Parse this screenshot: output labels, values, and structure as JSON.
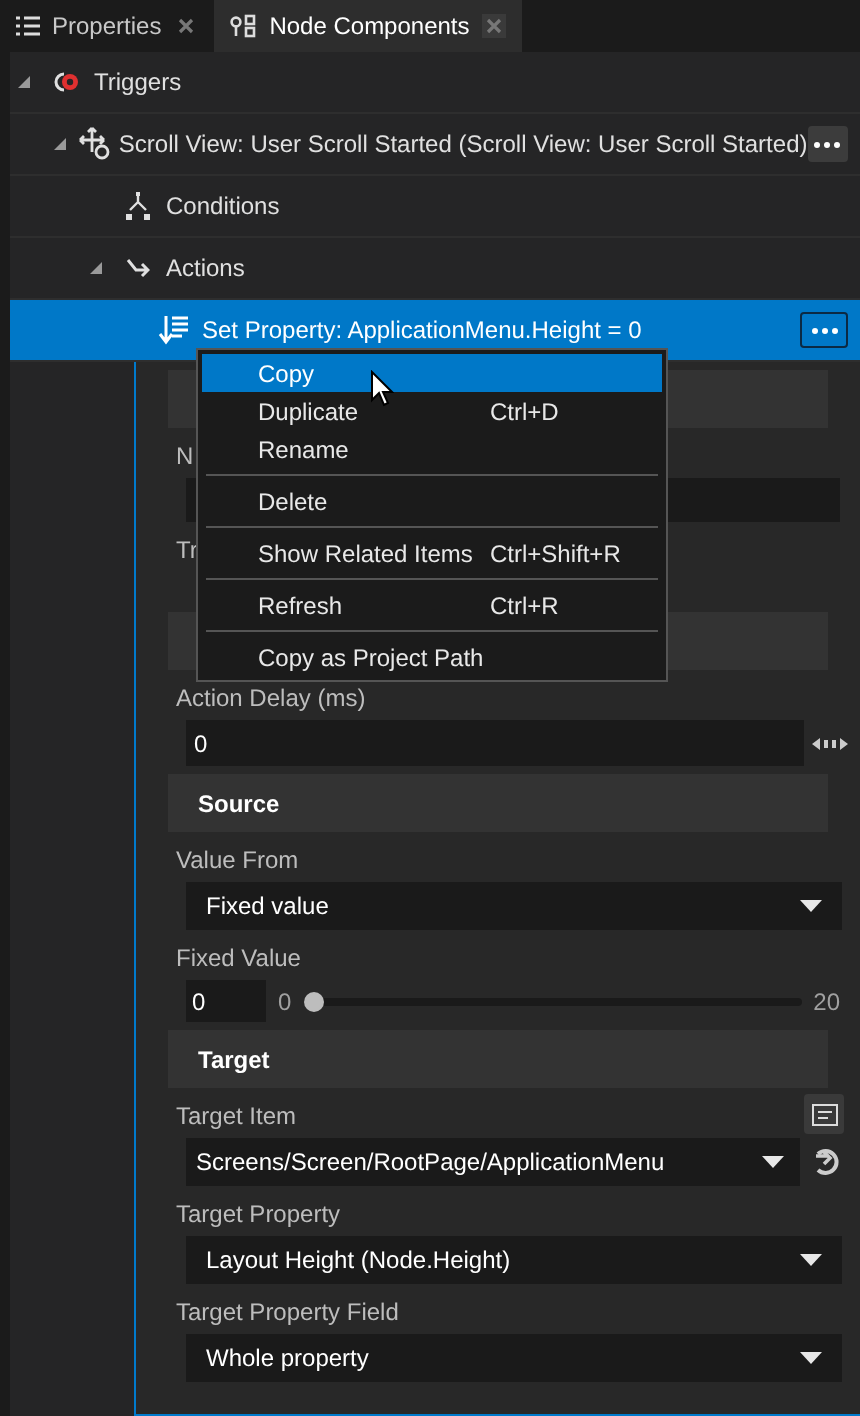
{
  "tabs": [
    {
      "label": "Properties",
      "kind": "list",
      "selected": false
    },
    {
      "label": "Node Components",
      "kind": "components",
      "selected": true
    }
  ],
  "tree": [
    {
      "label": "Triggers",
      "kind": "trigger",
      "expanded": true,
      "selected": false,
      "children": [
        {
          "label": "Scroll View: User Scroll Started (Scroll View: User Scroll Started)",
          "kind": "event",
          "expanded": true,
          "selected": false,
          "children": [
            {
              "label": "Conditions",
              "kind": "conditions",
              "selected": false
            },
            {
              "label": "Actions",
              "kind": "actions",
              "expanded": true,
              "selected": false,
              "children": [
                {
                  "label": "Set Property: ApplicationMenu.Height = 0",
                  "kind": "action",
                  "selected": true
                }
              ]
            }
          ]
        }
      ]
    }
  ],
  "properties": [
    {
      "kind": "header"
    },
    {
      "kind": "label",
      "text": "N"
    },
    {
      "kind": "input"
    },
    {
      "kind": "label",
      "text": "Tr"
    },
    {
      "kind": "spacer"
    },
    {
      "kind": "header"
    },
    {
      "kind": "label",
      "text": "Action Delay (ms)"
    },
    {
      "kind": "number",
      "value": "0"
    },
    {
      "kind": "header",
      "text": "Source"
    },
    {
      "kind": "label",
      "text": "Value From"
    },
    {
      "kind": "dropdown",
      "value": "Fixed value"
    },
    {
      "kind": "label",
      "text": "Fixed Value"
    },
    {
      "kind": "slider",
      "value": "0",
      "min": "0",
      "max": "20",
      "level": 0
    },
    {
      "kind": "header",
      "text": "Target"
    },
    {
      "kind": "picker_label",
      "text": "Target Item"
    },
    {
      "kind": "link_dropdown",
      "value": "Screens/Screen/RootPage/ApplicationMenu"
    },
    {
      "kind": "label",
      "text": "Target Property"
    },
    {
      "kind": "dropdown",
      "value": "Layout Height (Node.Height)"
    },
    {
      "kind": "label",
      "text": "Target Property Field"
    },
    {
      "kind": "dropdown",
      "value": "Whole property"
    }
  ],
  "context_menu": [
    {
      "kind": "item",
      "label": "Copy",
      "selected": true
    },
    {
      "kind": "item",
      "label": "Duplicate",
      "shortcut": "Ctrl+D",
      "selected": false
    },
    {
      "kind": "item",
      "label": "Rename",
      "selected": false
    },
    {
      "kind": "separator"
    },
    {
      "kind": "item",
      "label": "Delete",
      "selected": false
    },
    {
      "kind": "separator"
    },
    {
      "kind": "item",
      "label": "Show Related Items",
      "shortcut": "Ctrl+Shift+R",
      "selected": false
    },
    {
      "kind": "separator"
    },
    {
      "kind": "item",
      "label": "Refresh",
      "shortcut": "Ctrl+R",
      "selected": false
    },
    {
      "kind": "separator"
    },
    {
      "kind": "item",
      "label": "Copy as Project Path",
      "selected": false
    }
  ]
}
